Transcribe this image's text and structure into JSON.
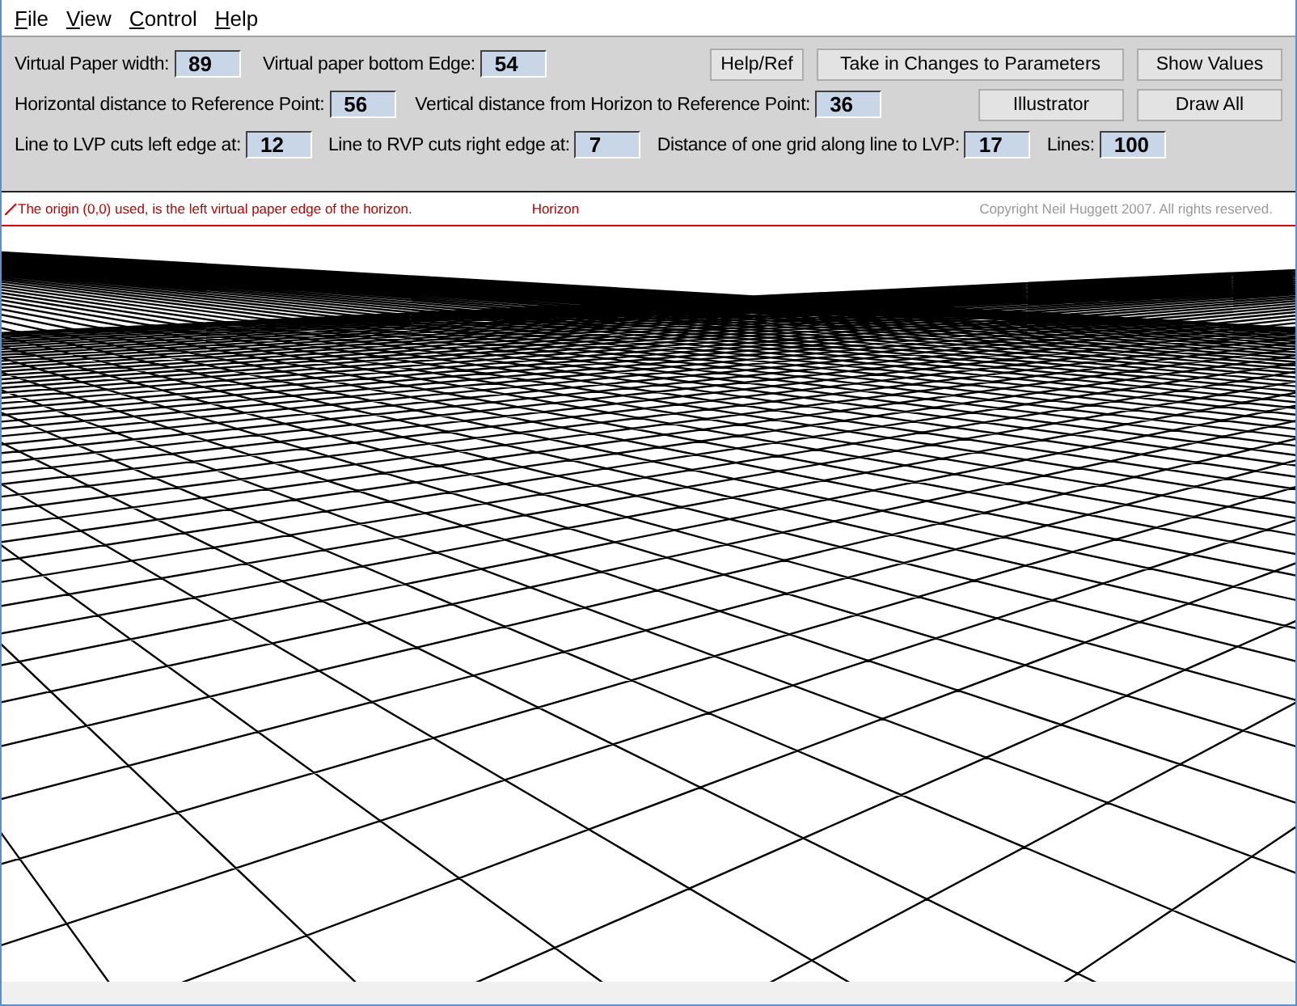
{
  "menu": [
    "File",
    "View",
    "Control",
    "Help"
  ],
  "rows": [
    {
      "fields": [
        {
          "label": "Virtual Paper width:",
          "value": "89"
        },
        {
          "label": "Virtual paper bottom Edge:",
          "value": "54"
        }
      ],
      "buttons": [
        "Help/Ref",
        "Take in Changes to Parameters",
        "Show Values"
      ]
    },
    {
      "fields": [
        {
          "label": "Horizontal distance to Reference Point:",
          "value": "56"
        },
        {
          "label": "Vertical distance from Horizon to Reference Point:",
          "value": "36"
        }
      ],
      "buttons": [
        "Illustrator",
        "Draw All"
      ]
    },
    {
      "fields": [
        {
          "label": "Line to LVP cuts left edge at:",
          "value": "12"
        },
        {
          "label": "Line to RVP cuts right edge at:",
          "value": "7"
        },
        {
          "label": "Distance of one grid along line to LVP:",
          "value": "17"
        },
        {
          "label": "Lines:",
          "value": "100"
        }
      ],
      "buttons": []
    }
  ],
  "info": {
    "origin_note": "The origin (0,0) used, is the left virtual paper edge of the horizon.",
    "horizon_label": "Horizon",
    "copyright": "Copyright Neil Huggett 2007. All rights reserved."
  }
}
